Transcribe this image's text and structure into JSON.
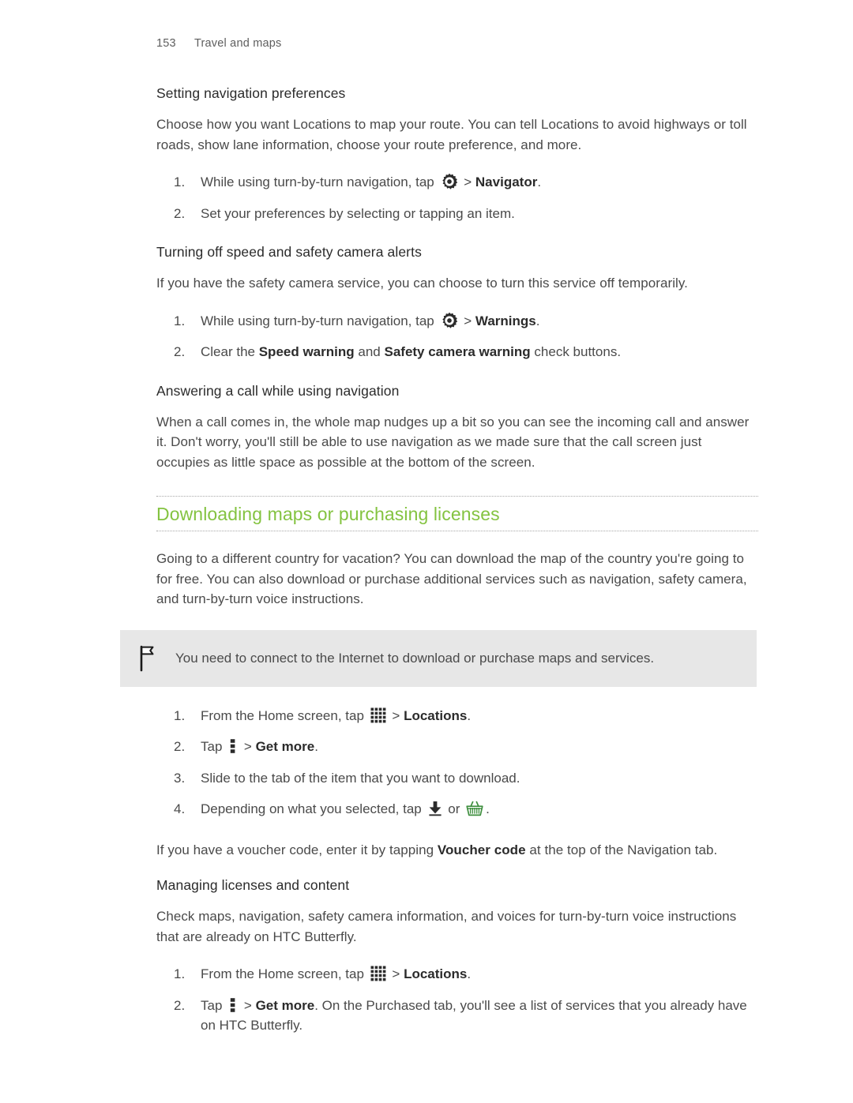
{
  "header": {
    "page_number": "153",
    "chapter": "Travel and maps"
  },
  "sections": {
    "nav_prefs": {
      "heading": "Setting navigation preferences",
      "intro": "Choose how you want Locations to map your route. You can tell Locations to avoid highways or toll roads, show lane information, choose your route preference, and more.",
      "step1_before": "While using turn-by-turn navigation, tap",
      "step1_sep": ">",
      "step1_bold": "Navigator",
      "step1_after": ".",
      "step2": "Set your preferences by selecting or tapping an item."
    },
    "camera_alerts": {
      "heading": "Turning off speed and safety camera alerts",
      "intro": "If you have the safety camera service, you can choose to turn this service off temporarily.",
      "step1_before": "While using turn-by-turn navigation, tap",
      "step1_sep": ">",
      "step1_bold": "Warnings",
      "step1_after": ".",
      "step2_a": "Clear the",
      "step2_bold1": "Speed warning",
      "step2_b": "and",
      "step2_bold2": "Safety camera warning",
      "step2_c": "check buttons."
    },
    "answering_call": {
      "heading": "Answering a call while using navigation",
      "body": "When a call comes in, the whole map nudges up a bit so you can see the incoming call and answer it. Don't worry, you'll still be able to use navigation as we made sure that the call screen just occupies as little space as possible at the bottom of the screen."
    },
    "downloading": {
      "heading": "Downloading maps or purchasing licenses",
      "intro": "Going to a different country for vacation? You can download the map of the country you're going to for free. You can also download or purchase additional services such as navigation, safety camera, and turn-by-turn voice instructions.",
      "note": "You need to connect to the Internet to download or purchase maps and services.",
      "step1_before": "From the Home screen, tap",
      "step1_sep": ">",
      "step1_bold": "Locations",
      "step1_after": ".",
      "step2_before": "Tap",
      "step2_sep": ">",
      "step2_bold": "Get more",
      "step2_after": ".",
      "step3": "Slide to the tab of the item that you want to download.",
      "step4_before": "Depending on what you selected, tap",
      "step4_or": "or",
      "step4_after": ".",
      "voucher_a": "If you have a voucher code, enter it by tapping",
      "voucher_bold": "Voucher code",
      "voucher_b": "at the top of the Navigation tab."
    },
    "managing": {
      "heading": "Managing licenses and content",
      "intro": "Check maps, navigation, safety camera information, and voices for turn-by-turn voice instructions that are already on HTC Butterfly.",
      "step1_before": "From the Home screen, tap",
      "step1_sep": ">",
      "step1_bold": "Locations",
      "step1_after": ".",
      "step2_before": "Tap",
      "step2_sep": ">",
      "step2_bold": "Get more",
      "step2_after": ". On the Purchased tab, you'll see a list of services that you already have on HTC Butterfly."
    }
  },
  "icons": {
    "gear": "settings-gear-icon",
    "grid": "all-apps-grid-icon",
    "dots": "overflow-menu-icon",
    "download": "download-arrow-icon",
    "basket": "shopping-basket-icon",
    "flag": "note-flag-icon"
  },
  "colors": {
    "heading_green": "#84c341",
    "note_background": "#e7e7e7",
    "body_text": "#4a4a4a",
    "basket_green": "#3f8f3f"
  }
}
